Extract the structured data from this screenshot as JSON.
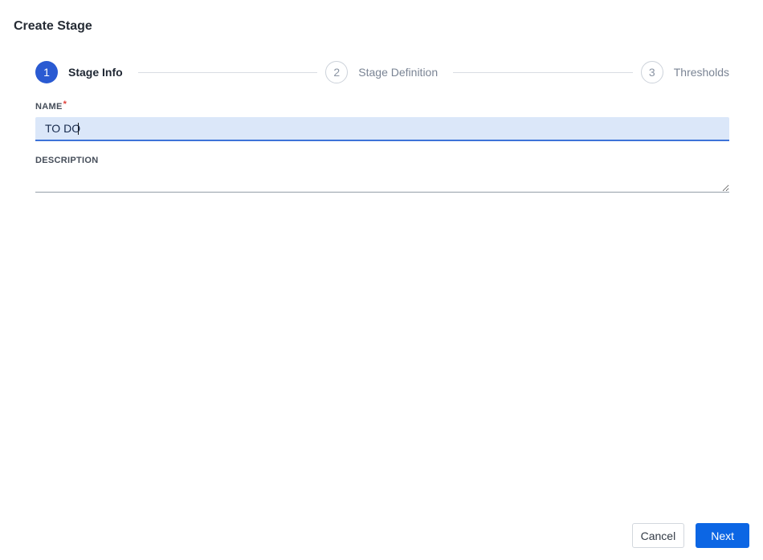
{
  "page": {
    "title": "Create Stage"
  },
  "stepper": {
    "steps": [
      {
        "number": "1",
        "label": "Stage Info",
        "state": "active"
      },
      {
        "number": "2",
        "label": "Stage Definition",
        "state": "inactive"
      },
      {
        "number": "3",
        "label": "Thresholds",
        "state": "inactive"
      }
    ]
  },
  "form": {
    "name": {
      "label": "NAME",
      "required_marker": "*",
      "value": "TO DO",
      "placeholder": ""
    },
    "description": {
      "label": "DESCRIPTION",
      "value": ""
    }
  },
  "footer": {
    "cancel_label": "Cancel",
    "next_label": "Next"
  },
  "colors": {
    "step_active_blue": "#2a5ad2",
    "next_button_blue": "#0c66e4",
    "input_focus_bg": "#dbe7f9",
    "input_focus_border": "#3d73d8",
    "required_red": "#e0403a"
  }
}
